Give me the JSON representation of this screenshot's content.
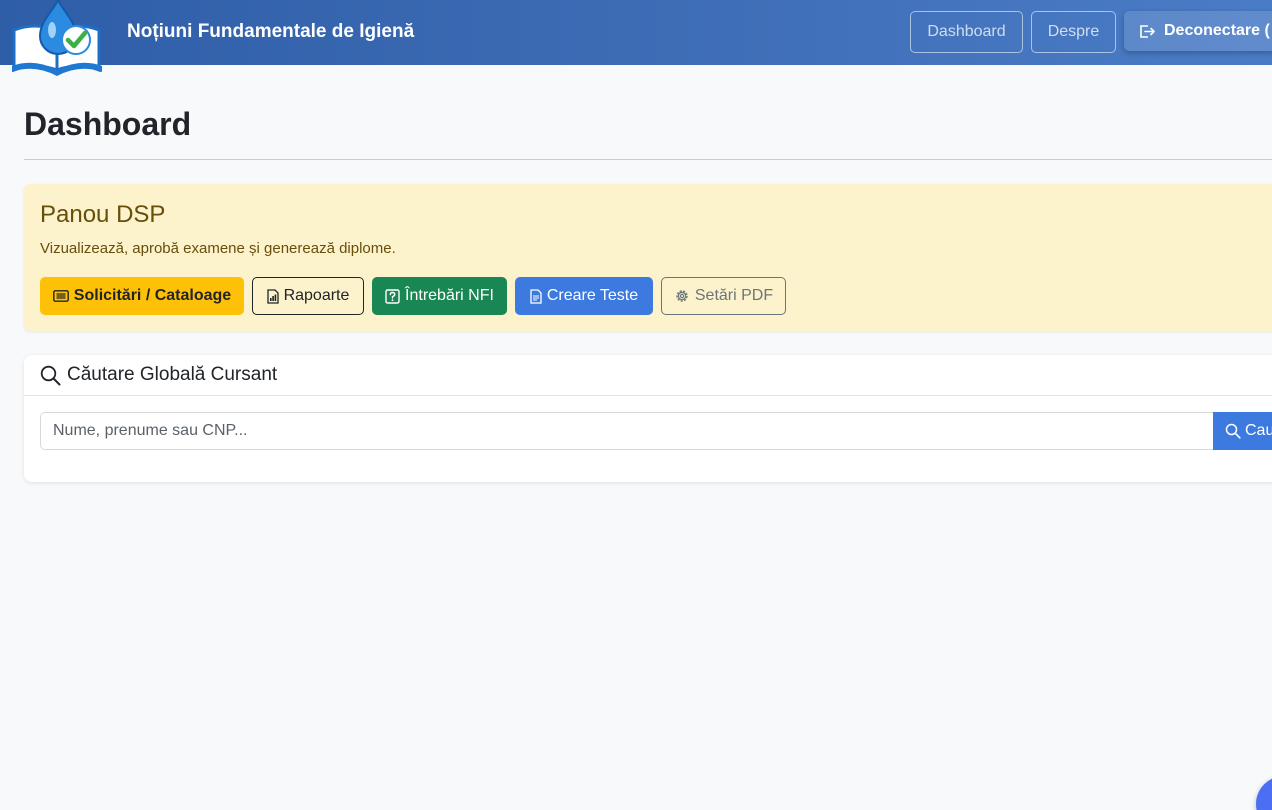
{
  "navbar": {
    "brand": "Noțiuni Fundamentale de Igienă",
    "links": {
      "dashboard": "Dashboard",
      "despre": "Despre"
    },
    "logout_label": "Deconectare ("
  },
  "page": {
    "title": "Dashboard"
  },
  "dsp_panel": {
    "title": "Panou DSP",
    "description": "Vizualizează, aprobă examene și generează diplome.",
    "buttons": {
      "solicitari": "Solicitări / Cataloage",
      "rapoarte": "Rapoarte",
      "intrebari": "Întrebări NFI",
      "creare": "Creare Teste",
      "setari": "Setări PDF"
    }
  },
  "search": {
    "title": "Căutare Globală Cursant",
    "placeholder": "Nume, prenume sau CNP...",
    "button_label": "Caută"
  },
  "colors": {
    "navbar": "#3d6cb5",
    "warning": "#ffc107",
    "success": "#198754",
    "primary": "#3d7ae0",
    "panel_bg": "#fcf3cc"
  },
  "icons": {
    "logo": "book-water-drop-check-logo",
    "logout": "box-arrow-right-icon",
    "solicitari": "list-icon",
    "rapoarte": "bar-chart-file-icon",
    "intrebari": "question-square-icon",
    "creare": "file-text-icon",
    "setari": "gear-icon",
    "search": "search-icon"
  }
}
